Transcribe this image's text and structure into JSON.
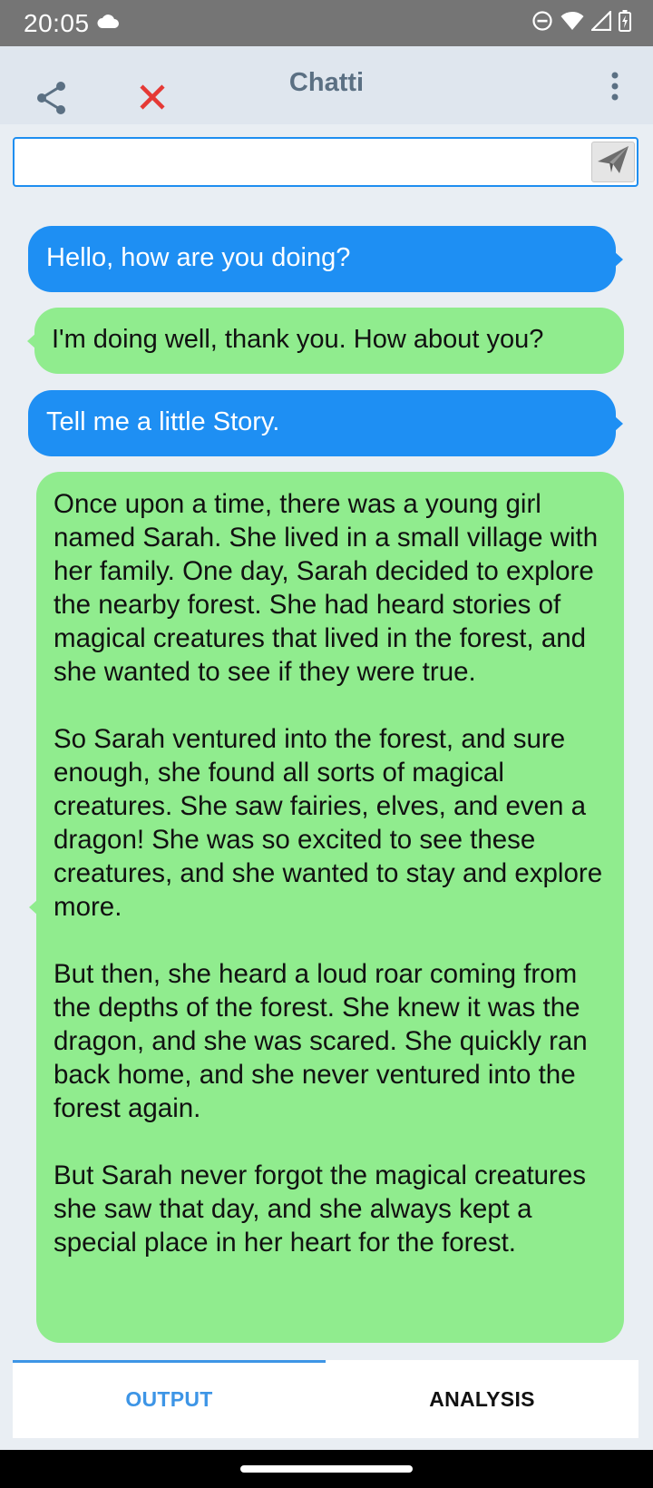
{
  "status_bar": {
    "time": "20:05",
    "icons": [
      "cloud-icon",
      "do-not-disturb-icon",
      "wifi-icon",
      "signal-icon",
      "battery-icon"
    ]
  },
  "app_bar": {
    "title": "Chatti",
    "icons": [
      "share-icon",
      "close-icon",
      "more-vert-icon"
    ],
    "close_color": "#e53935"
  },
  "input": {
    "value": "",
    "placeholder": ""
  },
  "messages": [
    {
      "role": "user",
      "text": "Hello, how are you doing?"
    },
    {
      "role": "assistant",
      "text": "I'm doing well, thank you. How about you?"
    },
    {
      "role": "user",
      "text": "Tell me a little Story."
    },
    {
      "role": "assistant",
      "text": "Once upon a time, there was a young girl named Sarah. She lived in a small village with her family. One day, Sarah decided to explore the nearby forest. She had heard stories of magical creatures that lived in the forest, and she wanted to see if they were true.\n\nSo Sarah ventured into the forest, and sure enough, she found all sorts of magical creatures. She saw fairies, elves, and even a dragon! She was so excited to see these creatures, and she wanted to stay and explore more.\n\nBut then, she heard a loud roar coming from the depths of the forest. She knew it was the dragon, and she was scared. She quickly ran back home, and she never ventured into the forest again.\n\nBut Sarah never forgot the magical creatures she saw that day, and she always kept a special place in her heart for the forest."
    }
  ],
  "tabs": [
    {
      "label": "OUTPUT",
      "active": true
    },
    {
      "label": "ANALYSIS",
      "active": false
    }
  ],
  "colors": {
    "user_bubble": "#1e8ff3",
    "assistant_bubble": "#90ec8e",
    "accent": "#3d95e6",
    "app_bar": "#dfe6ee",
    "background": "#e9eef3"
  }
}
